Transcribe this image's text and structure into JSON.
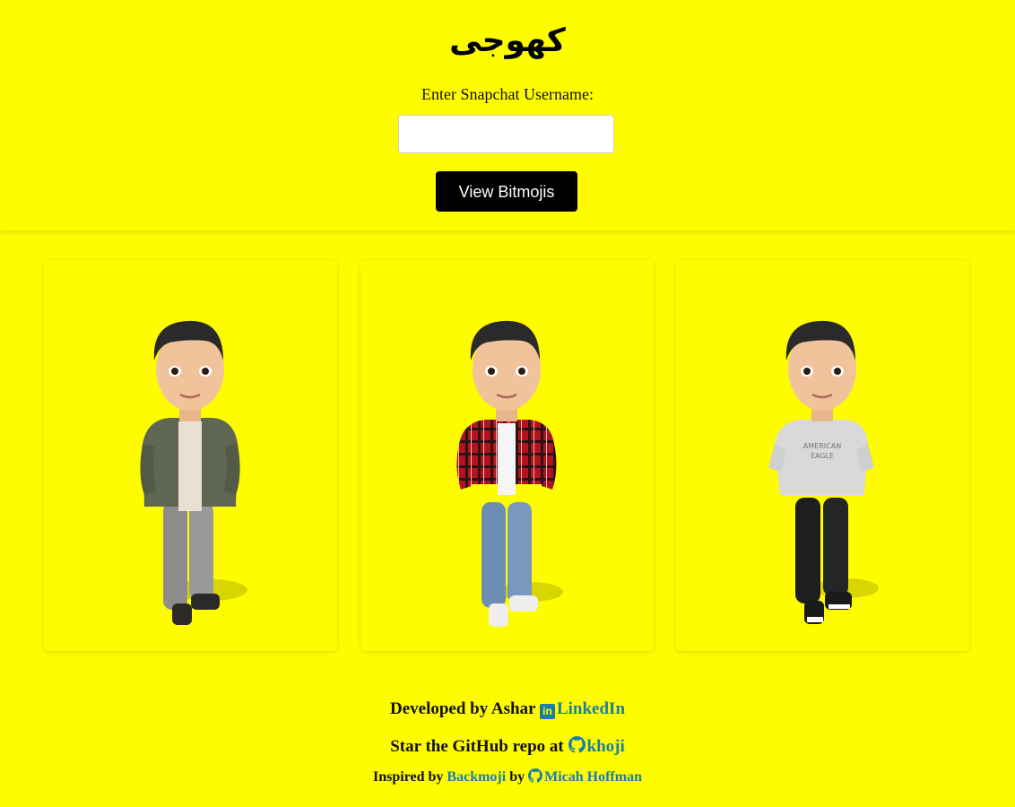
{
  "header": {
    "title": "کھوجی",
    "input_label": "Enter Snapchat Username:",
    "input_value": "",
    "input_placeholder": "",
    "button_label": "View Bitmojis"
  },
  "cards": [
    {
      "name": "bitmoji-green-jacket",
      "jacket_color": "#5f6651",
      "pants_color": "#8d8d8d",
      "shoe_color": "#2b2a28"
    },
    {
      "name": "bitmoji-plaid-shirt",
      "jacket_color": "#b3141c",
      "pants_color": "#6d8db3",
      "shoe_color": "#eeeeee"
    },
    {
      "name": "bitmoji-tshirt",
      "shirt_text": "AMERICAN EAGLE",
      "shirt_color": "#d9d9d9",
      "pants_color": "#1e1e1e",
      "shoe_color": "#1a1a1a"
    }
  ],
  "footer": {
    "line1_prefix": "Developed by Ashar",
    "line1_link_icon": "in",
    "line1_link": "LinkedIn",
    "line2_prefix": "Star the GitHub repo at",
    "line2_link": "khoji",
    "line3_prefix": "Inspired by",
    "line3_link1": "Backmoji",
    "line3_mid": "by",
    "line3_link2": "Micah Hoffman"
  },
  "colors": {
    "background": "#fffc00",
    "link": "#1a7ea6",
    "button": "#000000"
  }
}
